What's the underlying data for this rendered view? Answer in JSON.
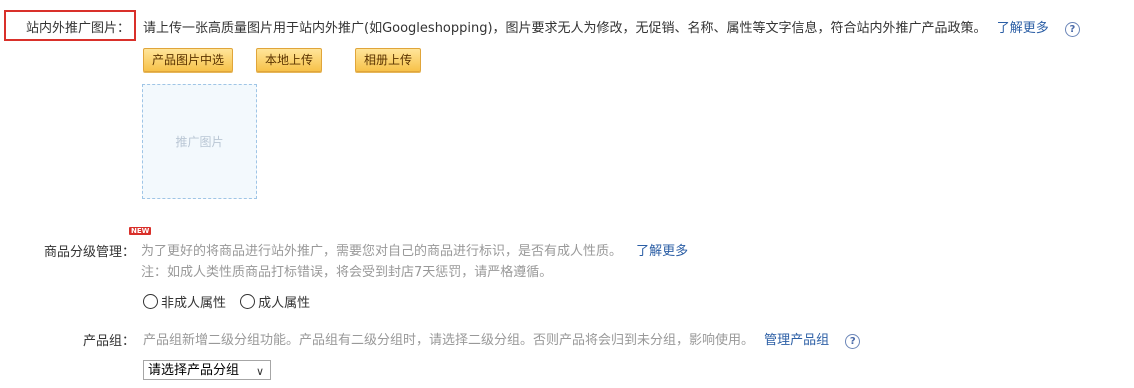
{
  "promo_image": {
    "label": "站内外推广图片：",
    "desc": "请上传一张高质量图片用于站内外推广(如Googleshopping)，图片要求无人为修改，无促销、名称、属性等文字信息，符合站内外推广产品政策。",
    "learn_more": "了解更多",
    "buttons": [
      "产品图片中选",
      "本地上传",
      "相册上传"
    ],
    "placeholder": "推广图片"
  },
  "grading": {
    "label": "商品分级管理：",
    "badge": "NEW",
    "desc": "为了更好的将商品进行站外推广，需要您对自己的商品进行标识，是否有成人性质。",
    "learn_more": "了解更多",
    "note": "注：如成人类性质商品打标错误，将会受到封店7天惩罚，请严格遵循。",
    "options": [
      "非成人属性",
      "成人属性"
    ]
  },
  "product_group": {
    "label": "产品组：",
    "desc": "产品组新增二级分组功能。产品组有二级分组时，请选择二级分组。否则产品将会归到未分组，影响使用。",
    "manage_link": "管理产品组",
    "select_value": "请选择产品分组"
  },
  "icons": {
    "help": "?",
    "chevron": "∨"
  },
  "colors": {
    "highlight_border": "#d9302a",
    "link": "#2b5ea5",
    "button_bg": "#f7c24a"
  }
}
